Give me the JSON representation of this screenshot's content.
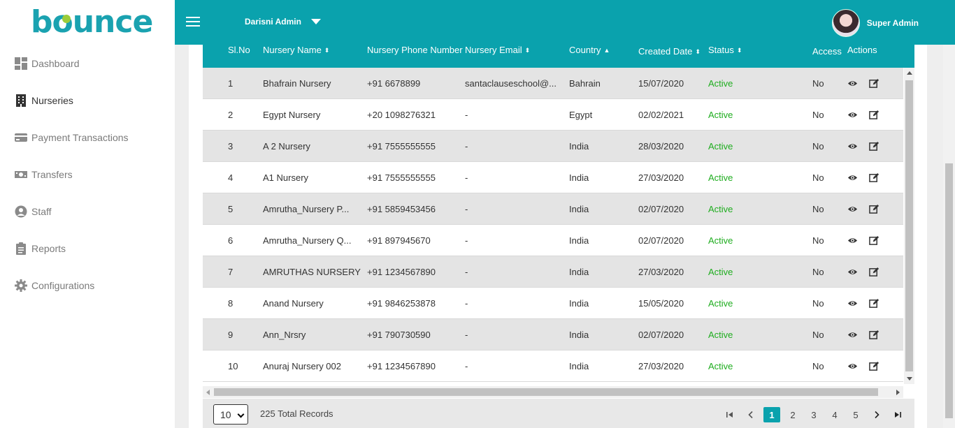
{
  "brand": {
    "logo_text": "bounce"
  },
  "header": {
    "nursery_name": "Darisni Admin",
    "user_name": "Super Admin"
  },
  "sidebar": {
    "items": [
      {
        "label": "Dashboard",
        "icon": "dashboard-icon",
        "active": false
      },
      {
        "label": "Nurseries",
        "icon": "building-icon",
        "active": true
      },
      {
        "label": "Payment Transactions",
        "icon": "credit-card-icon",
        "active": false
      },
      {
        "label": "Transfers",
        "icon": "money-icon",
        "active": false
      },
      {
        "label": "Staff",
        "icon": "user-circle-icon",
        "active": false
      },
      {
        "label": "Reports",
        "icon": "clipboard-icon",
        "active": false
      },
      {
        "label": "Configurations",
        "icon": "gear-icon",
        "active": false
      }
    ]
  },
  "table": {
    "columns": [
      {
        "label": "Sl.No",
        "sort": ""
      },
      {
        "label": "Nursery Name",
        "sort": "⬍"
      },
      {
        "label": "Nursery Phone Number",
        "sort": ""
      },
      {
        "label": "Nursery Email",
        "sort": "⬍"
      },
      {
        "label": "Country",
        "sort": "▲"
      },
      {
        "label": "Created Date",
        "sort": "⬍"
      },
      {
        "label": "Status",
        "sort": "⬍"
      },
      {
        "label": "Access",
        "sort": ""
      },
      {
        "label": "Actions",
        "sort": ""
      }
    ],
    "rows": [
      {
        "sl": "1",
        "name": "Bhafrain Nursery",
        "phone": "+91 6678899",
        "email": "santaclauseschool@...",
        "country": "Bahrain",
        "date": "15/07/2020",
        "status": "Active",
        "access": "No"
      },
      {
        "sl": "2",
        "name": "Egypt Nursery",
        "phone": "+20 1098276321",
        "email": "-",
        "country": "Egypt",
        "date": "02/02/2021",
        "status": "Active",
        "access": "No"
      },
      {
        "sl": "3",
        "name": "A 2 Nursery",
        "phone": "+91 7555555555",
        "email": "-",
        "country": "India",
        "date": "28/03/2020",
        "status": "Active",
        "access": "No"
      },
      {
        "sl": "4",
        "name": "A1 Nursery",
        "phone": "+91 7555555555",
        "email": "-",
        "country": "India",
        "date": "27/03/2020",
        "status": "Active",
        "access": "No"
      },
      {
        "sl": "5",
        "name": "Amrutha_Nursery P...",
        "phone": "+91 5859453456",
        "email": "-",
        "country": "India",
        "date": "02/07/2020",
        "status": "Active",
        "access": "No"
      },
      {
        "sl": "6",
        "name": "Amrutha_Nursery Q...",
        "phone": "+91 897945670",
        "email": "-",
        "country": "India",
        "date": "02/07/2020",
        "status": "Active",
        "access": "No"
      },
      {
        "sl": "7",
        "name": "AMRUTHAS NURSERY",
        "phone": "+91 1234567890",
        "email": "-",
        "country": "India",
        "date": "27/03/2020",
        "status": "Active",
        "access": "No"
      },
      {
        "sl": "8",
        "name": "Anand Nursery",
        "phone": "+91 9846253878",
        "email": "-",
        "country": "India",
        "date": "15/05/2020",
        "status": "Active",
        "access": "No"
      },
      {
        "sl": "9",
        "name": "Ann_Nrsry",
        "phone": "+91 790730590",
        "email": "-",
        "country": "India",
        "date": "02/07/2020",
        "status": "Active",
        "access": "No"
      },
      {
        "sl": "10",
        "name": "Anuraj Nursery 002",
        "phone": "+91 1234567890",
        "email": "-",
        "country": "India",
        "date": "27/03/2020",
        "status": "Active",
        "access": "No"
      }
    ]
  },
  "footer": {
    "page_size": "10",
    "total_records": "225 Total Records",
    "pages": [
      "1",
      "2",
      "3",
      "4",
      "5"
    ],
    "current_page": "1"
  },
  "colors": {
    "accent": "#0aa2ad",
    "status_active": "#1fad1f",
    "logo_dot": "#9ccc3a"
  }
}
